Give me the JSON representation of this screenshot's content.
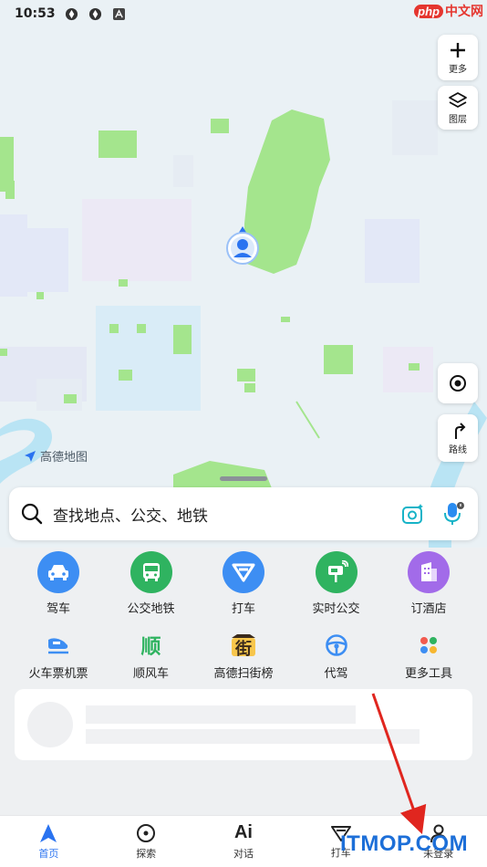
{
  "status_bar": {
    "time": "10:53"
  },
  "watermark_top": {
    "badge": "php",
    "text": "中文网"
  },
  "map_controls": {
    "more_label": "更多",
    "layers_label": "图层",
    "route_label": "路线"
  },
  "map": {
    "logo_text": "高德地图"
  },
  "search": {
    "placeholder": "查找地点、公交、地铁"
  },
  "primary_shortcuts": [
    {
      "label": "驾车",
      "icon": "car-icon",
      "color": "#3d8ef3"
    },
    {
      "label": "公交地铁",
      "icon": "bus-icon",
      "color": "#2fb360"
    },
    {
      "label": "打车",
      "icon": "taxi-icon",
      "color": "#3d8ef3"
    },
    {
      "label": "实时公交",
      "icon": "realtime-bus-icon",
      "color": "#2fb360"
    },
    {
      "label": "订酒店",
      "icon": "hotel-icon",
      "color": "#a26be9"
    }
  ],
  "secondary_shortcuts": [
    {
      "label": "火车票机票",
      "icon": "train-icon"
    },
    {
      "label": "顺风车",
      "icon": "rideshare-icon",
      "glyph": "顺"
    },
    {
      "label": "高德扫街榜",
      "icon": "street-ranking-icon",
      "glyph": "街"
    },
    {
      "label": "代驾",
      "icon": "steering-wheel-icon"
    },
    {
      "label": "更多工具",
      "icon": "more-tools-icon"
    }
  ],
  "bottom_nav": [
    {
      "label": "首页",
      "icon": "home-arrow-icon",
      "active": true
    },
    {
      "label": "探索",
      "icon": "explore-pin-icon",
      "active": false
    },
    {
      "label": "对话",
      "icon": "ai-icon",
      "glyph": "Ai",
      "active": false
    },
    {
      "label": "打车",
      "icon": "taxi-nav-icon",
      "active": false
    },
    {
      "label": "未登录",
      "icon": "user-icon",
      "active": false
    }
  ],
  "watermark_bottom": "ITMOP.COM",
  "colors": {
    "accent": "#2a73f0",
    "park_green": "#a4e58d",
    "water": "#b9e4f4",
    "arrow_red": "#e0261f"
  }
}
